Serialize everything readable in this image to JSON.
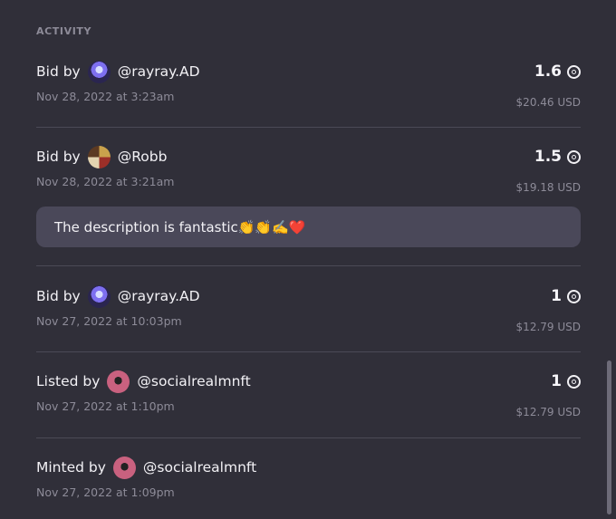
{
  "activity": {
    "title": "ACTIVITY",
    "rows": [
      {
        "action": "Bid by",
        "handle": "@rayray.AD",
        "avatar": "rayray-avatar",
        "amount": "1.6",
        "date": "Nov 28, 2022 at 3:23am",
        "usd": "$20.46 USD"
      },
      {
        "action": "Bid by",
        "handle": "@Robb",
        "avatar": "robb-avatar",
        "amount": "1.5",
        "date": "Nov 28, 2022 at 3:21am",
        "usd": "$19.18 USD",
        "comment": "The description is fantastic👏👏✍️❤️"
      },
      {
        "action": "Bid by",
        "handle": "@rayray.AD",
        "avatar": "rayray-avatar",
        "amount": "1",
        "date": "Nov 27, 2022 at 10:03pm",
        "usd": "$12.79 USD"
      },
      {
        "action": "Listed by",
        "handle": "@socialrealmnft",
        "avatar": "socialrealmnft-avatar",
        "amount": "1",
        "date": "Nov 27, 2022 at 1:10pm",
        "usd": "$12.79 USD"
      },
      {
        "action": "Minted by",
        "handle": "@socialrealmnft",
        "avatar": "socialrealmnft-avatar",
        "date": "Nov 27, 2022 at 1:09pm"
      }
    ]
  },
  "colors": {
    "background": "#302f39",
    "comment_bg": "#4a4859",
    "muted_text": "#8d8b98"
  },
  "icons": {
    "currency": "tezos-icon"
  }
}
